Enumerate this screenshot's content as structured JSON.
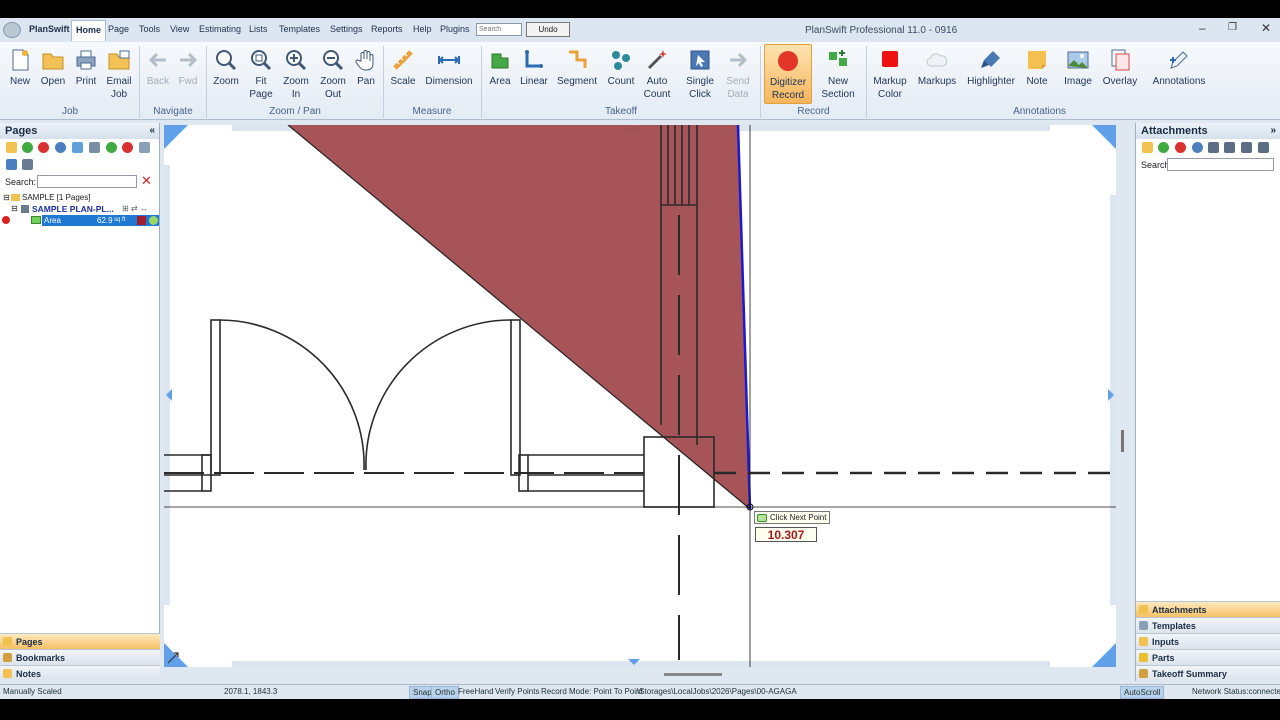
{
  "app": {
    "logo_label": "PlanSwift",
    "window_title": "PlanSwift Professional 11.0 - 0916",
    "search_placeholder": "Search",
    "undo_label": "Undo"
  },
  "menu": [
    "Home",
    "Page",
    "Tools",
    "View",
    "Estimating",
    "Lists",
    "Templates",
    "Settings",
    "Reports",
    "Help",
    "Plugins"
  ],
  "ribbon": {
    "buttons": [
      {
        "id": "new",
        "l1": "New",
        "l2": ""
      },
      {
        "id": "open",
        "l1": "Open",
        "l2": ""
      },
      {
        "id": "print",
        "l1": "Print",
        "l2": ""
      },
      {
        "id": "email-job",
        "l1": "Email",
        "l2": "Job"
      },
      {
        "id": "back",
        "l1": "Back",
        "l2": ""
      },
      {
        "id": "fwd",
        "l1": "Fwd",
        "l2": ""
      },
      {
        "id": "zoom",
        "l1": "Zoom",
        "l2": ""
      },
      {
        "id": "fit-page",
        "l1": "Fit",
        "l2": "Page"
      },
      {
        "id": "zoom-in",
        "l1": "Zoom",
        "l2": "In"
      },
      {
        "id": "zoom-out",
        "l1": "Zoom",
        "l2": "Out"
      },
      {
        "id": "pan",
        "l1": "Pan",
        "l2": ""
      },
      {
        "id": "scale",
        "l1": "Scale",
        "l2": ""
      },
      {
        "id": "dimension",
        "l1": "Dimension",
        "l2": ""
      },
      {
        "id": "area",
        "l1": "Area",
        "l2": ""
      },
      {
        "id": "linear",
        "l1": "Linear",
        "l2": ""
      },
      {
        "id": "segment",
        "l1": "Segment",
        "l2": ""
      },
      {
        "id": "count",
        "l1": "Count",
        "l2": ""
      },
      {
        "id": "auto-count",
        "l1": "Auto",
        "l2": "Count"
      },
      {
        "id": "single-click",
        "l1": "Single",
        "l2": "Click"
      },
      {
        "id": "send-data",
        "l1": "Send",
        "l2": "Data"
      },
      {
        "id": "digitizer-record",
        "l1": "Digitizer",
        "l2": "Record"
      },
      {
        "id": "new-section",
        "l1": "New",
        "l2": "Section"
      },
      {
        "id": "markup-color",
        "l1": "Markup",
        "l2": "Color"
      },
      {
        "id": "markups",
        "l1": "Markups",
        "l2": ""
      },
      {
        "id": "highlighter",
        "l1": "Highlighter",
        "l2": ""
      },
      {
        "id": "note",
        "l1": "Note",
        "l2": ""
      },
      {
        "id": "image",
        "l1": "Image",
        "l2": ""
      },
      {
        "id": "overlay",
        "l1": "Overlay",
        "l2": ""
      },
      {
        "id": "annotations",
        "l1": "Annotations",
        "l2": ""
      }
    ],
    "groups": [
      "Job",
      "Navigate",
      "Zoom / Pan",
      "Measure",
      "Takeoff",
      "Record",
      "Annotations"
    ]
  },
  "left_panel": {
    "title": "Pages",
    "search_label": "Search:",
    "tree": {
      "job": "SAMPLE [1 Pages]",
      "page": "SAMPLE PLAN-PL...",
      "item_name": "Area",
      "item_value": "62.9",
      "item_unit": "sq ft"
    },
    "tabs": [
      "Pages",
      "Bookmarks",
      "Notes"
    ]
  },
  "right_panel": {
    "title": "Attachments",
    "search_label": "Search:",
    "tabs": [
      "Attachments",
      "Templates",
      "Inputs",
      "Parts",
      "Takeoff Summary"
    ]
  },
  "canvas": {
    "tooltip": "Click Next Point",
    "measurement": "10.307"
  },
  "status": {
    "scale": "Manually Scaled",
    "coords": "2078.1, 1843.3",
    "snap": "Snap",
    "ortho": "Ortho",
    "freehand": "FreeHand",
    "verify": "Verify Points",
    "record_mode": "Record Mode: Point To Point",
    "path": "\\Storages\\LocalJobs\\2026\\Pages\\00-AGAGA",
    "autoscroll": "AutoScroll",
    "network": "Network Status:connected"
  },
  "colors": {
    "area_fill": "#a24b4f",
    "active_line": "#1a1ad0",
    "accent": "#f6b65c"
  }
}
